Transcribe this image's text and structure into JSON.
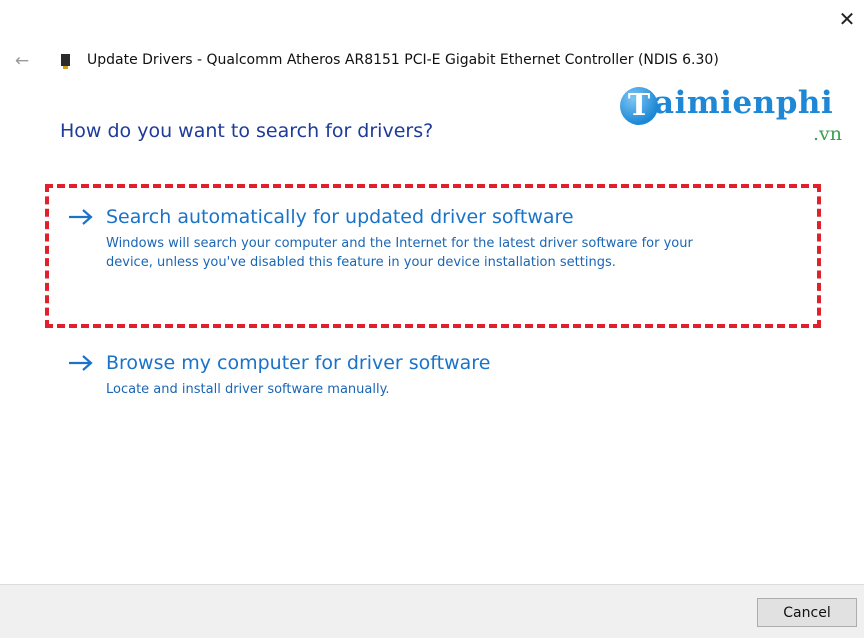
{
  "window": {
    "close_glyph": "✕",
    "back_glyph": "←",
    "title": "Update Drivers - Qualcomm Atheros AR8151 PCI-E Gigabit Ethernet Controller (NDIS 6.30)"
  },
  "watermark": {
    "badge_letter": "T",
    "text": "aimienphi",
    "suffix": ".vn"
  },
  "main": {
    "question": "How do you want to search for drivers?",
    "options": [
      {
        "title": "Search automatically for updated driver software",
        "description": "Windows will search your computer and the Internet for the latest driver software for your device, unless you've disabled this feature in your device installation settings.",
        "highlighted": true
      },
      {
        "title": "Browse my computer for driver software",
        "description": "Locate and install driver software manually.",
        "highlighted": false
      }
    ]
  },
  "footer": {
    "cancel_label": "Cancel"
  },
  "colors": {
    "link_blue": "#1a73c8",
    "heading_blue": "#1e3b9a",
    "highlight_red": "#e0202a",
    "footer_bg": "#f0f0f0"
  }
}
